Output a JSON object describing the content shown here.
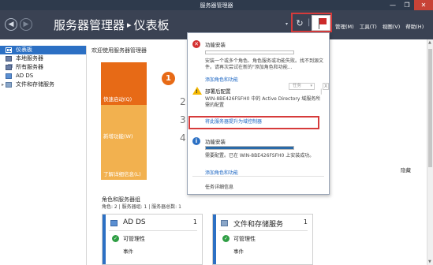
{
  "window": {
    "title": "服务器管理器",
    "controls": [
      "—",
      "❐",
      "✕"
    ]
  },
  "header": {
    "back": "◀",
    "forward": "▶",
    "app_name": "服务器管理器",
    "separator": "▸",
    "page_name": "仪表板",
    "dropdown_arrow": "▾",
    "refresh": "↻",
    "pipe": "|",
    "menus": [
      "管理(M)",
      "工具(T)",
      "视图(V)",
      "帮助(H)"
    ]
  },
  "sidebar": {
    "items": [
      {
        "label": "仪表板",
        "active": true
      },
      {
        "label": "本地服务器"
      },
      {
        "label": "所有服务器"
      },
      {
        "label": "AD DS"
      },
      {
        "label": "文件和存储服务",
        "expander": "▸"
      }
    ]
  },
  "main": {
    "welcome": "欢迎使用服务器管理器",
    "tiles": {
      "quick": "快速启动(Q)",
      "new": "新增功能(W)",
      "more": "了解详细信息(L)"
    },
    "step_number": "1",
    "steps": [
      "2",
      "3",
      "4"
    ],
    "hide": "隐藏",
    "roles_title": "角色和服务器组",
    "roles_sub": "角色: 2 | 服务器组: 1 | 服务器总数: 1",
    "cards": [
      {
        "name": "AD DS",
        "count": "1",
        "status": "可管理性",
        "events": "事件"
      },
      {
        "name": "文件和存储服务",
        "count": "1",
        "status": "可管理性",
        "events": "事件"
      }
    ]
  },
  "notifications": {
    "items": [
      {
        "type": "error",
        "title": "功能安装",
        "progress": 0,
        "description": "安装一个或多个角色、角色服务或功能失败。找不到源文件。请再次尝试在新的\"添加角色和功能...",
        "link": "添加角色和功能"
      },
      {
        "type": "warning",
        "title": "部署后配置",
        "task_dropdown": "任务",
        "close": "X",
        "description": "WIN-8BE426FSFH0 中的 Active Directory 域服务所需的配置",
        "link": "将此服务器提升为域控制器"
      },
      {
        "type": "info",
        "title": "功能安装",
        "progress": 1,
        "description": "需要配置。已在 WIN-8BE426FSFH0 上安装成功。",
        "link": "添加角色和功能"
      }
    ],
    "task_details": "任务详细信息"
  }
}
